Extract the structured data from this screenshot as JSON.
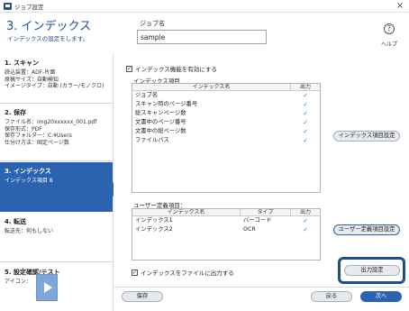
{
  "window": {
    "title": "ジョブ設定"
  },
  "header": {
    "heading": "3. インデックス",
    "subtitle": "インデックスの設定をします。",
    "jobname_label": "ジョブ名",
    "jobname_value": "sample",
    "help_label": "ヘルプ"
  },
  "sidebar": {
    "steps": [
      {
        "title": "1. スキャン",
        "details": [
          "読込装置：ADF-片面",
          "原稿サイズ：自動検知",
          "イメージタイプ：自動 (カラー/モノクロ)"
        ]
      },
      {
        "title": "2. 保存",
        "details": [
          "ファイル名：img20xxxxxx_001.pdf",
          "保存形式：PDF",
          "保存フォルダー：C:¥Users",
          "仕分け方法：固定ページ数"
        ]
      },
      {
        "title": "3. インデックス",
        "details": [
          "インデックス項目 8"
        ]
      },
      {
        "title": "4. 転送",
        "details": [
          "転送先：何もしない"
        ]
      },
      {
        "title": "5. 設定確認/テスト",
        "details": [
          "アイコン："
        ]
      }
    ]
  },
  "main": {
    "enable_index_label": "インデックス機能を有効にする",
    "index_items_group": "インデックス項目",
    "index_grid_headers": [
      "インデックス名",
      "出力"
    ],
    "index_items": [
      {
        "name": "ジョブ名",
        "output": "✓"
      },
      {
        "name": "スキャン時のページ番号",
        "output": "✓"
      },
      {
        "name": "総スキャンページ数",
        "output": "✓"
      },
      {
        "name": "文書中のページ番号",
        "output": "✓"
      },
      {
        "name": "文書中の総ページ数",
        "output": "✓"
      },
      {
        "name": "ファイルパス",
        "output": "✓"
      }
    ],
    "index_settings_button": "インデックス項目設定",
    "user_items_group": "ユーザー定義項目：",
    "user_grid_headers": [
      "インデックス名",
      "タイプ",
      "出力"
    ],
    "user_items": [
      {
        "name": "インデックス1",
        "type": "バーコード",
        "output": "✓"
      },
      {
        "name": "インデックス2",
        "type": "OCR",
        "output": "✓"
      }
    ],
    "user_settings_button": "ユーザー定義項目設定",
    "output_to_file_label": "インデックスをファイルに出力する",
    "output_settings_button": "出力設定"
  },
  "footer": {
    "save_button": "保存",
    "back_button": "戻る",
    "next_button": "次へ"
  },
  "colors": {
    "accent": "#2b63b0",
    "heading": "#1f4e8c",
    "check": "#2f7fd6"
  }
}
